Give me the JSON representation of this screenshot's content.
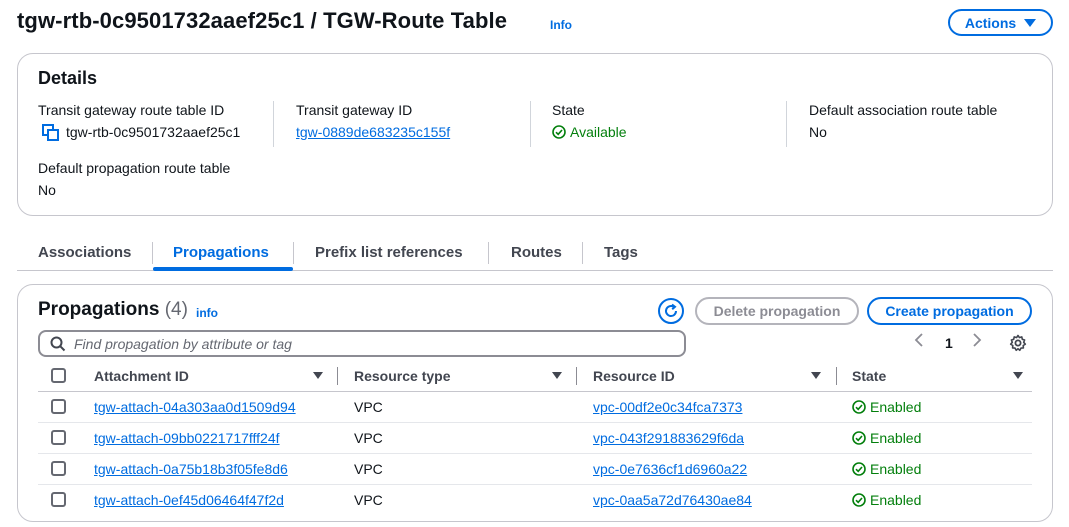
{
  "header": {
    "title": "tgw-rtb-0c9501732aaef25c1 / TGW-Route Table",
    "info": "Info",
    "actions_label": "Actions"
  },
  "details": {
    "heading": "Details",
    "fields": [
      {
        "label": "Transit gateway route table ID",
        "value": "tgw-rtb-0c9501732aaef25c1"
      },
      {
        "label": "Transit gateway ID",
        "value": "tgw-0889de683235c155f"
      },
      {
        "label": "State",
        "value": "Available"
      },
      {
        "label": "Default association route table",
        "value": "No"
      },
      {
        "label": "Default propagation route table",
        "value": "No"
      }
    ]
  },
  "tabs": [
    {
      "label": "Associations"
    },
    {
      "label": "Propagations"
    },
    {
      "label": "Prefix list references"
    },
    {
      "label": "Routes"
    },
    {
      "label": "Tags"
    }
  ],
  "propagations": {
    "heading": "Propagations",
    "count": "(4)",
    "info": "info",
    "delete_label": "Delete propagation",
    "create_label": "Create propagation",
    "search_placeholder": "Find propagation by attribute or tag",
    "page": "1",
    "columns": [
      "Attachment ID",
      "Resource type",
      "Resource ID",
      "State"
    ],
    "rows": [
      {
        "attachment": "tgw-attach-04a303aa0d1509d94",
        "type": "VPC",
        "resource": "vpc-00df2e0c34fca7373",
        "state": "Enabled"
      },
      {
        "attachment": "tgw-attach-09bb0221717fff24f",
        "type": "VPC",
        "resource": "vpc-043f291883629f6da",
        "state": "Enabled"
      },
      {
        "attachment": "tgw-attach-0a75b18b3f05fe8d6",
        "type": "VPC",
        "resource": "vpc-0e7636cf1d6960a22",
        "state": "Enabled"
      },
      {
        "attachment": "tgw-attach-0ef45d06464f47f2d",
        "type": "VPC",
        "resource": "vpc-0aa5a72d76430ae84",
        "state": "Enabled"
      }
    ]
  },
  "colors": {
    "accent": "#006ce0",
    "success": "#037f0c",
    "border": "#c6c6cd"
  }
}
